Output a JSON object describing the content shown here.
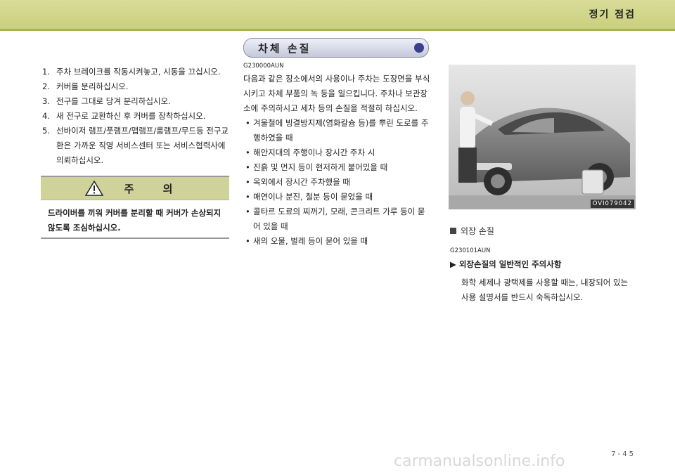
{
  "header": {
    "title": "정기 점검"
  },
  "left": {
    "items": [
      {
        "num": "1.",
        "text": "주차 브레이크를 작동시켜놓고, 시동을 끄십시오."
      },
      {
        "num": "2.",
        "text": "커버를 분리하십시오."
      },
      {
        "num": "3.",
        "text": "전구를 그대로 당겨 분리하십시오."
      },
      {
        "num": "4.",
        "text": "새 전구로 교환하신 후 커버를 장착하십시오."
      },
      {
        "num": "5.",
        "text": "선바이저 램프/풋램프/맵램프/룸램프/무드등 전구교환은 가까운 직영 서비스센터 또는 서비스협력사에 의뢰하십시오."
      }
    ],
    "caution": {
      "title": "주 의",
      "body": "드라이버를 끼워 커버를 분리할 때 커버가 손상되지 않도록 조심하십시오."
    }
  },
  "middle": {
    "pill_title": "차체 손질",
    "code": "G230000AUN",
    "intro": "다음과 같은 장소에서의 사용이나 주차는 도장면을 부식시키고 차체 부품의 녹 등을 일으킵니다. 주차나 보관장소에 주의하시고 세차 등의 손질을 적절히 하십시오.",
    "bullets": [
      "겨울철에 빙결방지제(염화칼슘 등)를 뿌린 도로를 주행하였을 때",
      "해안지대의 주행이나 장시간 주차 시",
      "진흙 및 먼지 등이 현저하게 붙어있을 때",
      "옥외에서 장시간 주차했을 때",
      "매연이나 분진, 철분 등이 묻었을 때",
      "콜타르 도료의 찌꺼기, 모래, 콘크리트 가루 등이 묻어 있을 때",
      "새의 오물, 벌레 등이 묻어 있을 때"
    ]
  },
  "right": {
    "photo_code": "OVI079042",
    "section_title": "외장 손질",
    "code": "G230101AUN",
    "sub_title": "▶ 외장손질의 일반적인 주의사항",
    "text": "화학 세제나 광택제를 사용할 때는, 내장되어 있는 사용 설명서를 반드시 숙독하십시오."
  },
  "page_number": "7-45",
  "watermark": "carmanualsonline.info"
}
